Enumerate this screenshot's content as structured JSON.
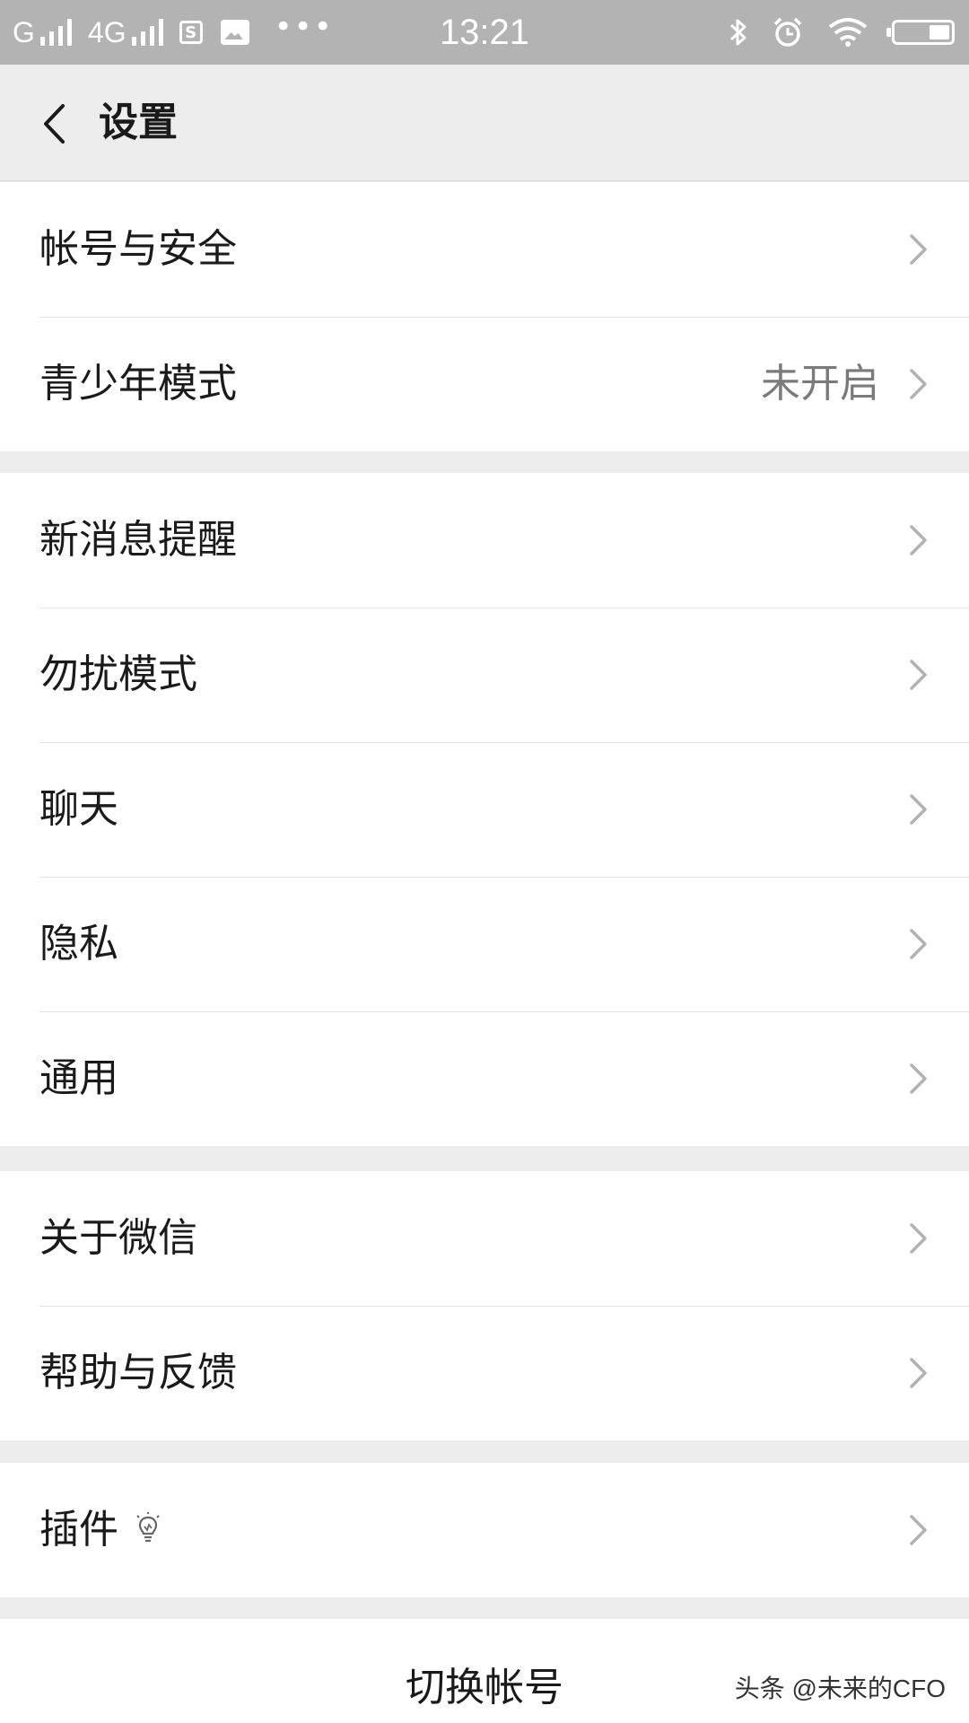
{
  "status_bar": {
    "network_1": "G",
    "network_2": "4G",
    "sim_icon_text": "S",
    "more": "•••",
    "time": "13:21"
  },
  "header": {
    "title": "设置"
  },
  "groups": [
    {
      "items": [
        {
          "label": "帐号与安全",
          "value": ""
        },
        {
          "label": "青少年模式",
          "value": "未开启"
        }
      ]
    },
    {
      "items": [
        {
          "label": "新消息提醒",
          "value": ""
        },
        {
          "label": "勿扰模式",
          "value": ""
        },
        {
          "label": "聊天",
          "value": ""
        },
        {
          "label": "隐私",
          "value": ""
        },
        {
          "label": "通用",
          "value": ""
        }
      ]
    },
    {
      "items": [
        {
          "label": "关于微信",
          "value": ""
        },
        {
          "label": "帮助与反馈",
          "value": ""
        }
      ]
    },
    {
      "items": [
        {
          "label": "插件",
          "value": "",
          "icon": "lightbulb-icon"
        }
      ]
    }
  ],
  "footer": {
    "switch_account": "切换帐号",
    "watermark": "头条 @未来的CFO"
  },
  "colors": {
    "status_bar_bg": "#b3b3b3",
    "page_bg": "#ededed",
    "cell_bg": "#ffffff",
    "secondary_text": "#7a7a7a"
  }
}
